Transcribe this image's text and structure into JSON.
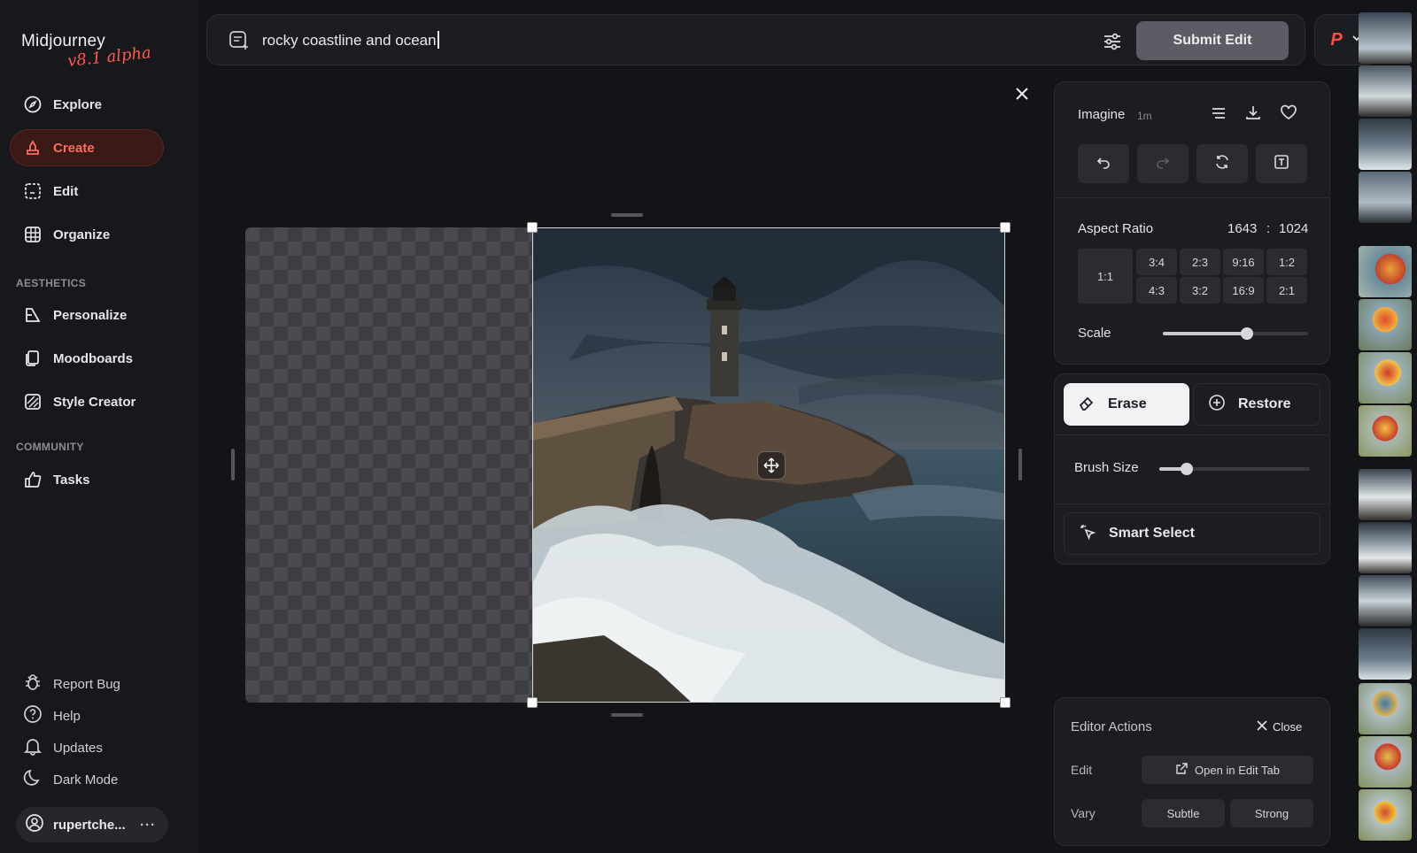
{
  "sidebar": {
    "logo": {
      "name": "Midjourney",
      "version": "v8.1 alpha"
    },
    "nav": [
      {
        "label": "Explore",
        "icon": "compass-icon"
      },
      {
        "label": "Create",
        "icon": "brush-icon",
        "active": true
      },
      {
        "label": "Edit",
        "icon": "edit-frame-icon"
      },
      {
        "label": "Organize",
        "icon": "grid-icon"
      }
    ],
    "aesthetics_heading": "AESTHETICS",
    "aesthetics": [
      {
        "label": "Personalize",
        "icon": "personalize-icon"
      },
      {
        "label": "Moodboards",
        "icon": "moodboard-icon"
      },
      {
        "label": "Style Creator",
        "icon": "style-creator-icon"
      }
    ],
    "community_heading": "COMMUNITY",
    "community": [
      {
        "label": "Tasks",
        "icon": "thumbs-up-icon"
      }
    ],
    "bottom": [
      {
        "label": "Report Bug",
        "icon": "bug-icon"
      },
      {
        "label": "Help",
        "icon": "help-icon"
      },
      {
        "label": "Updates",
        "icon": "bell-icon"
      },
      {
        "label": "Dark Mode",
        "icon": "moon-icon"
      }
    ],
    "user": {
      "name": "rupertche...",
      "more": "···"
    }
  },
  "prompt": {
    "text": "rocky coastline and ocean",
    "submit_label": "Submit Edit",
    "profile_letter": "P"
  },
  "image_panel": {
    "title": "Imagine",
    "age": "1m",
    "aspect_ratio_label": "Aspect Ratio",
    "aspect_w": "1643",
    "aspect_sep": ":",
    "aspect_h": "1024",
    "ratios": [
      "1:1",
      "3:4",
      "2:3",
      "9:16",
      "1:2",
      "4:3",
      "3:2",
      "16:9",
      "2:1"
    ],
    "scale_label": "Scale",
    "scale_value": 0.58
  },
  "tools": {
    "erase_label": "Erase",
    "restore_label": "Restore",
    "brush_label": "Brush Size",
    "brush_value": 0.18,
    "smart_select_label": "Smart Select"
  },
  "editor_actions": {
    "title": "Editor Actions",
    "close_label": "Close",
    "edit_label": "Edit",
    "open_edit_tab_label": "Open in Edit Tab",
    "vary_label": "Vary",
    "subtle_label": "Subtle",
    "strong_label": "Strong"
  },
  "colors": {
    "accent": "#ff5a4f",
    "panel": "#1c1d22",
    "background": "#131418"
  }
}
